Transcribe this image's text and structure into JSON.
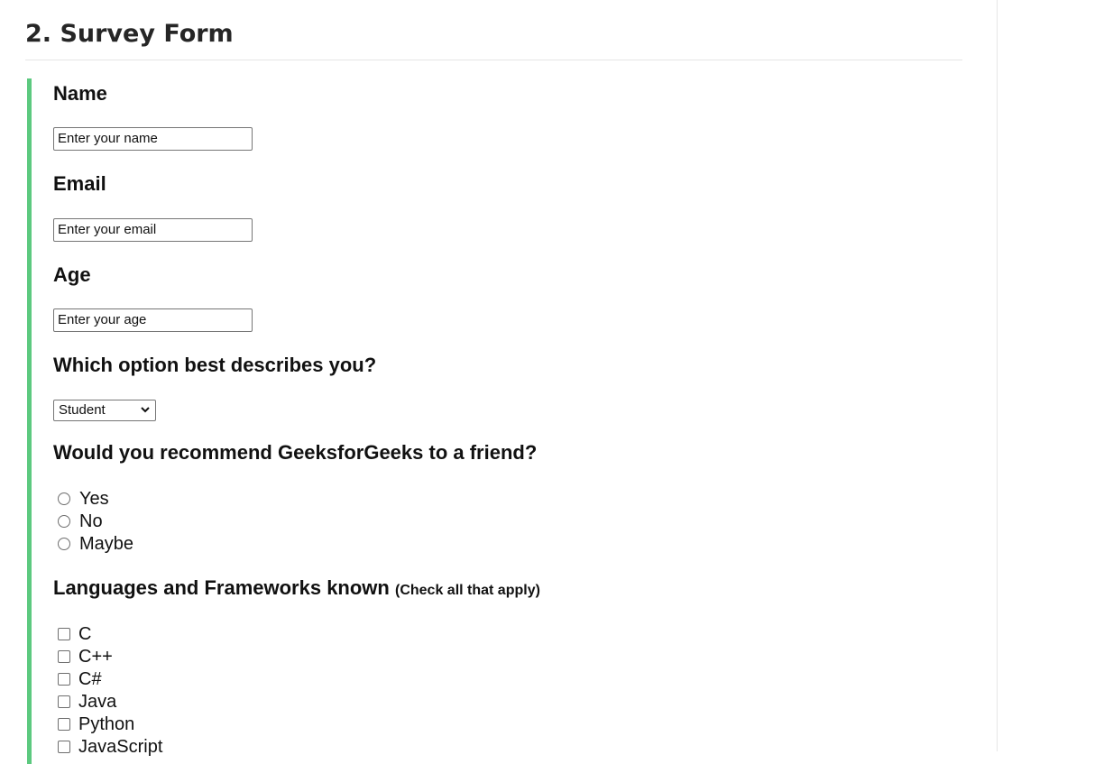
{
  "section": {
    "heading": "2. Survey Form"
  },
  "form": {
    "name": {
      "label": "Name",
      "placeholder": "Enter your name"
    },
    "email": {
      "label": "Email",
      "placeholder": "Enter your email"
    },
    "age": {
      "label": "Age",
      "placeholder": "Enter your age"
    },
    "role": {
      "label": "Which option best describes you?",
      "selected": "Student"
    },
    "recommend": {
      "label": "Would you recommend GeeksforGeeks to a friend?",
      "options": [
        "Yes",
        "No",
        "Maybe"
      ]
    },
    "languages": {
      "label": "Languages and Frameworks known",
      "hint": "(Check all that apply)",
      "options": [
        "C",
        "C++",
        "C#",
        "Java",
        "Python",
        "JavaScript"
      ]
    }
  },
  "colors": {
    "accent_bar": "#5cc97f",
    "heading": "#262626",
    "divider": "#e6e6e6"
  },
  "icons": {
    "select_arrow": "chevron-down-icon"
  }
}
